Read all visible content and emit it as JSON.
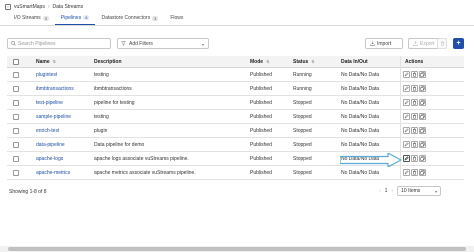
{
  "app": {
    "brand": "vuSmartMaps",
    "breadcrumb": "Data Streams"
  },
  "tabs": [
    {
      "label": "I/O Streams",
      "count": "3"
    },
    {
      "label": "Pipelines",
      "count": "8"
    },
    {
      "label": "Datastore Connectors",
      "count": "3"
    },
    {
      "label": "Flows",
      "count": ""
    }
  ],
  "toolbar": {
    "search_placeholder": "Search Pipelines",
    "filter_label": "Add Filters",
    "import_label": "Import",
    "export_label": "Export",
    "add_label": "+"
  },
  "table": {
    "columns": {
      "name": "Name",
      "description": "Description",
      "mode": "Mode",
      "status": "Status",
      "data": "Data In/Out",
      "actions": "Actions"
    },
    "rows": [
      {
        "name": "plugintest",
        "description": "testing",
        "mode": "Published",
        "status": "Running",
        "data": "No Data/No Data"
      },
      {
        "name": "ibmbtransactions",
        "description": "ibmbtransactions",
        "mode": "Published",
        "status": "Running",
        "data": "No Data/No Data"
      },
      {
        "name": "test-pipeline",
        "description": "pipeline for testing",
        "mode": "Published",
        "status": "Stopped",
        "data": "No Data/No Data"
      },
      {
        "name": "sample-pipeline",
        "description": "testing",
        "mode": "Published",
        "status": "Stopped",
        "data": "No Data/No Data"
      },
      {
        "name": "enrich-test",
        "description": "plugin",
        "mode": "Published",
        "status": "Stopped",
        "data": "No Data/No Data"
      },
      {
        "name": "data-pipeline",
        "description": "Data pipeline for demo",
        "mode": "Published",
        "status": "Stopped",
        "data": "No Data/No Data"
      },
      {
        "name": "apache-logs",
        "description": "apache logs associate vuStreams pipeline.",
        "mode": "Published",
        "status": "Stopped",
        "data": "No Data/No Data"
      },
      {
        "name": "apache-metrics",
        "description": "apache metrics associate vuStreams pipeline.",
        "mode": "Published",
        "status": "Stopped",
        "data": "No Data/No Data"
      }
    ]
  },
  "footer": {
    "showing": "Showing 1-8 of 8",
    "page": "1",
    "page_size": "10 Items"
  },
  "colors": {
    "accent": "#1f4fa8",
    "arrow": "#5aa9d6"
  }
}
